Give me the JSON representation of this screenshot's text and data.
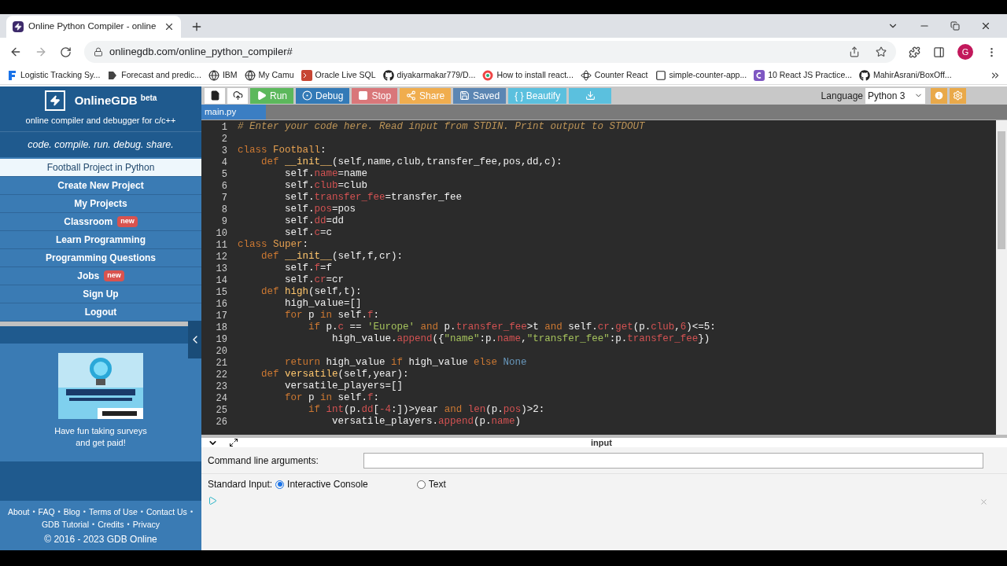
{
  "browser": {
    "tab": {
      "title": "Online Python Compiler - online"
    },
    "url": "onlinegdb.com/online_python_compiler#",
    "bookmarks": [
      {
        "label": "Logistic Tracking Sy..."
      },
      {
        "label": "Forecast and predic..."
      },
      {
        "label": "IBM"
      },
      {
        "label": "My Camu"
      },
      {
        "label": "Oracle Live SQL"
      },
      {
        "label": "diyakarmakar779/D..."
      },
      {
        "label": "How to install react..."
      },
      {
        "label": "Counter React"
      },
      {
        "label": "simple-counter-app..."
      },
      {
        "label": "10 React JS Practice..."
      },
      {
        "label": "MahirAsrani/BoxOff..."
      }
    ],
    "avatar": "G"
  },
  "sidebar": {
    "logo": {
      "name": "OnlineGDB",
      "badge": "beta",
      "subtitle": "online compiler and debugger for c/c++"
    },
    "tagline": "code. compile. run. debug. share.",
    "items": [
      {
        "label": "Football Project in Python",
        "selected": true
      },
      {
        "label": "Create New Project",
        "selected": false
      },
      {
        "label": "My Projects",
        "selected": false
      },
      {
        "label": "Classroom",
        "badge": "new",
        "selected": false
      },
      {
        "label": "Learn Programming",
        "selected": false
      },
      {
        "label": "Programming Questions",
        "selected": false
      },
      {
        "label": "Jobs",
        "badge": "new",
        "selected": false
      },
      {
        "label": "Sign Up",
        "selected": false
      },
      {
        "label": "Logout",
        "selected": false
      }
    ],
    "ad": {
      "kind": "picture",
      "caption": "Have fun taking surveys and get paid!"
    },
    "footer": {
      "items": [
        {
          "kind": "link",
          "text": "About"
        },
        {
          "kind": "separator",
          "text": "•"
        },
        {
          "kind": "link",
          "text": "FAQ"
        },
        {
          "kind": "separator",
          "text": "•"
        },
        {
          "kind": "link",
          "text": "Blog"
        },
        {
          "kind": "separator",
          "text": "•"
        },
        {
          "kind": "link",
          "text": "Terms of Use"
        },
        {
          "kind": "separator",
          "text": "•"
        },
        {
          "kind": "link",
          "text": "Contact Us"
        },
        {
          "kind": "separator",
          "text": "•"
        },
        {
          "kind": "link",
          "text": "GDB Tutorial"
        },
        {
          "kind": "separator",
          "text": "•"
        },
        {
          "kind": "link",
          "text": "Credits"
        },
        {
          "kind": "separator",
          "text": "•"
        },
        {
          "kind": "link",
          "text": "Privacy"
        }
      ],
      "copyright": "© 2016 - 2023 GDB Online"
    }
  },
  "toolbar": {
    "buttons": [
      {
        "color": "#ffffff"
      },
      {
        "color": "#ffffff"
      },
      {
        "label": "Run",
        "color": "#5cb85c"
      },
      {
        "label": "Debug",
        "color": "#337ab7"
      },
      {
        "label": "Stop",
        "color": "#d9777a"
      },
      {
        "label": "Share",
        "color": "#f0ad4e"
      },
      {
        "label": "Saved",
        "color": "#5b86b3"
      },
      {
        "label": "{ } Beautify",
        "color": "#5bc0de"
      },
      {
        "color": "#5bc0de"
      }
    ],
    "language": {
      "label": "Language",
      "value": "Python 3"
    }
  },
  "file_tab": "main.py",
  "editor": {
    "lines": [
      {
        "number": "1",
        "tokens": [
          {
            "kind": "comment",
            "text": "# Enter your code here. Read input from STDIN. Print output to STDOUT"
          }
        ]
      },
      {
        "number": "2"
      },
      {
        "number": "3",
        "tokens": [
          {
            "kind": "keyword",
            "text": "class"
          },
          {
            "kind": "classname",
            "text": " Football"
          },
          {
            "kind": "plain",
            "text": ":"
          }
        ]
      },
      {
        "number": "4",
        "tokens": [
          {
            "kind": "keyword",
            "text": "    def"
          },
          {
            "kind": "function",
            "text": " __init__"
          },
          {
            "kind": "plain",
            "text": "(self,name,club,transfer_fee,pos,dd,c):"
          }
        ]
      },
      {
        "number": "5",
        "tokens": [
          {
            "kind": "plain",
            "text": "        self."
          },
          {
            "kind": "attr",
            "text": "name"
          },
          {
            "kind": "plain",
            "text": "=name"
          }
        ]
      },
      {
        "number": "6",
        "tokens": [
          {
            "kind": "plain",
            "text": "        self."
          },
          {
            "kind": "attr",
            "text": "club"
          },
          {
            "kind": "plain",
            "text": "=club"
          }
        ]
      },
      {
        "number": "7",
        "tokens": [
          {
            "kind": "plain",
            "text": "        self."
          },
          {
            "kind": "attr",
            "text": "transfer_fee"
          },
          {
            "kind": "plain",
            "text": "=transfer_fee"
          }
        ]
      },
      {
        "number": "8",
        "tokens": [
          {
            "kind": "plain",
            "text": "        self."
          },
          {
            "kind": "attr",
            "text": "pos"
          },
          {
            "kind": "plain",
            "text": "=pos"
          }
        ]
      },
      {
        "number": "9",
        "tokens": [
          {
            "kind": "plain",
            "text": "        self."
          },
          {
            "kind": "attr",
            "text": "dd"
          },
          {
            "kind": "plain",
            "text": "=dd"
          }
        ]
      },
      {
        "number": "10",
        "tokens": [
          {
            "kind": "plain",
            "text": "        self."
          },
          {
            "kind": "attr",
            "text": "c"
          },
          {
            "kind": "plain",
            "text": "=c"
          }
        ]
      },
      {
        "number": "11",
        "tokens": [
          {
            "kind": "keyword",
            "text": "class"
          },
          {
            "kind": "classname",
            "text": " Super"
          },
          {
            "kind": "plain",
            "text": ":"
          }
        ]
      },
      {
        "number": "12",
        "tokens": [
          {
            "kind": "keyword",
            "text": "    def"
          },
          {
            "kind": "function",
            "text": " __init__"
          },
          {
            "kind": "plain",
            "text": "(self,f,cr):"
          }
        ]
      },
      {
        "number": "13",
        "tokens": [
          {
            "kind": "plain",
            "text": "        self."
          },
          {
            "kind": "attr",
            "text": "f"
          },
          {
            "kind": "plain",
            "text": "=f"
          }
        ]
      },
      {
        "number": "14",
        "tokens": [
          {
            "kind": "plain",
            "text": "        self."
          },
          {
            "kind": "attr",
            "text": "cr"
          },
          {
            "kind": "plain",
            "text": "=cr"
          }
        ]
      },
      {
        "number": "15",
        "tokens": [
          {
            "kind": "keyword",
            "text": "    def"
          },
          {
            "kind": "function",
            "text": " high"
          },
          {
            "kind": "plain",
            "text": "(self,t):"
          }
        ]
      },
      {
        "number": "16",
        "tokens": [
          {
            "kind": "plain",
            "text": "        high_value=[]"
          }
        ]
      },
      {
        "number": "17",
        "tokens": [
          {
            "kind": "keyword",
            "text": "        for"
          },
          {
            "kind": "plain",
            "text": " p "
          },
          {
            "kind": "keyword",
            "text": "in"
          },
          {
            "kind": "plain",
            "text": " self."
          },
          {
            "kind": "attr",
            "text": "f"
          },
          {
            "kind": "plain",
            "text": ":"
          }
        ]
      },
      {
        "number": "18",
        "tokens": [
          {
            "kind": "keyword",
            "text": "            if"
          },
          {
            "kind": "plain",
            "text": " p."
          },
          {
            "kind": "attr",
            "text": "c"
          },
          {
            "kind": "plain",
            "text": " == "
          },
          {
            "kind": "string",
            "text": "'Europe'"
          },
          {
            "kind": "keyword",
            "text": " and"
          },
          {
            "kind": "plain",
            "text": " p."
          },
          {
            "kind": "attr",
            "text": "transfer_fee"
          },
          {
            "kind": "plain",
            "text": ">t "
          },
          {
            "kind": "keyword",
            "text": "and"
          },
          {
            "kind": "plain",
            "text": " self."
          },
          {
            "kind": "attr",
            "text": "cr"
          },
          {
            "kind": "plain",
            "text": "."
          },
          {
            "kind": "attr",
            "text": "get"
          },
          {
            "kind": "plain",
            "text": "(p."
          },
          {
            "kind": "attr",
            "text": "club"
          },
          {
            "kind": "plain",
            "text": ","
          },
          {
            "kind": "attr",
            "text": "6"
          },
          {
            "kind": "plain",
            "text": ")<=5:"
          }
        ]
      },
      {
        "number": "19",
        "tokens": [
          {
            "kind": "plain",
            "text": "                high_value."
          },
          {
            "kind": "attr",
            "text": "append"
          },
          {
            "kind": "plain",
            "text": "({"
          },
          {
            "kind": "string",
            "text": "\"name\""
          },
          {
            "kind": "plain",
            "text": ":p."
          },
          {
            "kind": "attr",
            "text": "name"
          },
          {
            "kind": "plain",
            "text": ","
          },
          {
            "kind": "string",
            "text": "\"transfer_fee\""
          },
          {
            "kind": "plain",
            "text": ":p."
          },
          {
            "kind": "attr",
            "text": "transfer_fee"
          },
          {
            "kind": "plain",
            "text": "})"
          }
        ]
      },
      {
        "number": "20"
      },
      {
        "number": "21",
        "tokens": [
          {
            "kind": "keyword",
            "text": "        return"
          },
          {
            "kind": "plain",
            "text": " high_value "
          },
          {
            "kind": "keyword",
            "text": "if"
          },
          {
            "kind": "plain",
            "text": " high_value "
          },
          {
            "kind": "keyword",
            "text": "else"
          },
          {
            "kind": "constant",
            "text": " None"
          }
        ]
      },
      {
        "number": "22",
        "tokens": [
          {
            "kind": "keyword",
            "text": "    def"
          },
          {
            "kind": "function",
            "text": " versatile"
          },
          {
            "kind": "plain",
            "text": "(self,year):"
          }
        ]
      },
      {
        "number": "23",
        "tokens": [
          {
            "kind": "plain",
            "text": "        versatile_players=[]"
          }
        ]
      },
      {
        "number": "24",
        "tokens": [
          {
            "kind": "keyword",
            "text": "        for"
          },
          {
            "kind": "plain",
            "text": " p "
          },
          {
            "kind": "keyword",
            "text": "in"
          },
          {
            "kind": "plain",
            "text": " self."
          },
          {
            "kind": "attr",
            "text": "f"
          },
          {
            "kind": "plain",
            "text": ":"
          }
        ]
      },
      {
        "number": "25",
        "tokens": [
          {
            "kind": "keyword",
            "text": "            if"
          },
          {
            "kind": "attr",
            "text": " int"
          },
          {
            "kind": "plain",
            "text": "(p."
          },
          {
            "kind": "attr",
            "text": "dd"
          },
          {
            "kind": "plain",
            "text": "["
          },
          {
            "kind": "attr",
            "text": "-4"
          },
          {
            "kind": "plain",
            "text": ":])>year "
          },
          {
            "kind": "keyword",
            "text": "and"
          },
          {
            "kind": "attr",
            "text": " len"
          },
          {
            "kind": "plain",
            "text": "(p."
          },
          {
            "kind": "attr",
            "text": "pos"
          },
          {
            "kind": "plain",
            "text": ")>2:"
          }
        ]
      },
      {
        "number": "26",
        "tokens": [
          {
            "kind": "plain",
            "text": "                versatile_players."
          },
          {
            "kind": "attr",
            "text": "append"
          },
          {
            "kind": "plain",
            "text": "(p."
          },
          {
            "kind": "attr",
            "text": "name"
          },
          {
            "kind": "plain",
            "text": ")"
          }
        ]
      }
    ]
  },
  "input_panel": {
    "title": "input",
    "args_label": "Command line arguments:",
    "stdin_label": "Standard Input:",
    "options": [
      {
        "label": "Interactive Console",
        "selected": true
      },
      {
        "label": "Text",
        "selected": false
      }
    ]
  }
}
